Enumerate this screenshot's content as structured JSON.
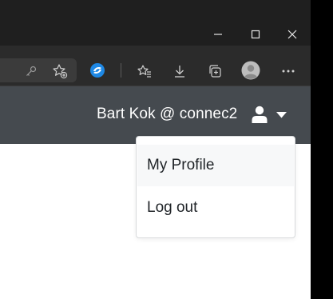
{
  "window_controls": {
    "minimize_icon": "minimize-icon",
    "maximize_icon": "maximize-icon",
    "close_icon": "close-icon"
  },
  "toolbar": {
    "icons": [
      "key-icon",
      "add-favorite-icon",
      "extension-icon",
      "favorites-icon",
      "downloads-icon",
      "collections-icon",
      "profile-avatar-icon",
      "more-icon"
    ]
  },
  "navbar": {
    "user_label": "Bart Kok @ connec2",
    "user_icon": "user-icon",
    "caret_icon": "caret-down-icon"
  },
  "dropdown": {
    "items": [
      {
        "label": "My Profile"
      },
      {
        "label": "Log out"
      }
    ]
  },
  "colors": {
    "navbar_bg": "#454a4f",
    "browser_chrome": "#2b2b2b",
    "titlebar": "#1f1f1f",
    "extension_accent": "#1e88e5"
  }
}
